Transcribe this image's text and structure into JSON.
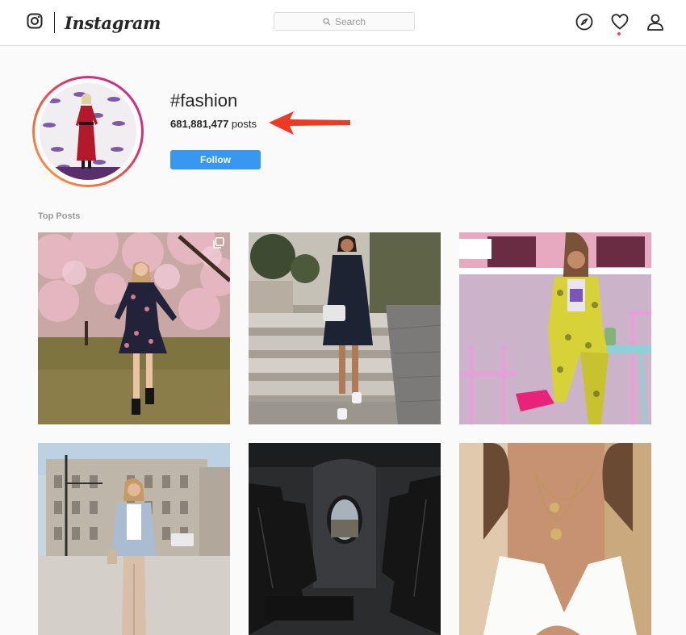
{
  "header": {
    "wordmark": "Instagram",
    "search_placeholder": "Search",
    "icons": [
      "instagram-camera-icon",
      "compass-icon",
      "heart-icon",
      "profile-icon"
    ],
    "notification_dot_color": "#ed4956"
  },
  "hashtag": {
    "name": "#fashion",
    "post_count": "681,881,477",
    "post_suffix": "posts",
    "follow_label": "Follow"
  },
  "colors": {
    "follow_button": "#3897f0",
    "annotation_arrow": "#ee3a23"
  },
  "top_posts": {
    "title": "Top Posts",
    "posts": [
      {
        "description": "woman in floral dress under cherry blossoms",
        "multiple": true
      },
      {
        "description": "woman in navy dress on stone steps"
      },
      {
        "description": "woman in yellow snake-print suit at cafe"
      },
      {
        "description": "woman in blazer on city street"
      },
      {
        "description": "airplane cabin with leather seats"
      },
      {
        "description": "woman in white top with pendant necklaces"
      }
    ]
  }
}
